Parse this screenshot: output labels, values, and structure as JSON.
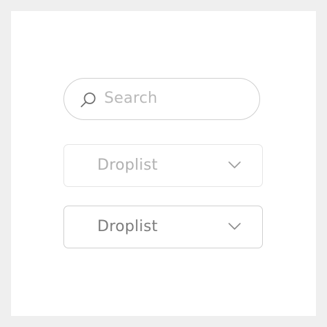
{
  "search": {
    "placeholder": "Search",
    "icon": "search-icon"
  },
  "droplists": [
    {
      "label": "Droplist",
      "state": "disabled",
      "icon": "chevron-down-icon"
    },
    {
      "label": "Droplist",
      "state": "enabled",
      "icon": "chevron-down-icon"
    }
  ],
  "colors": {
    "background": "#efefef",
    "card": "#ffffff",
    "border_light": "#e4e4e4",
    "border": "#cfcfcf",
    "text_muted": "#b1b1b1",
    "text": "#7d7d7d",
    "icon": "#6e6e6e"
  }
}
